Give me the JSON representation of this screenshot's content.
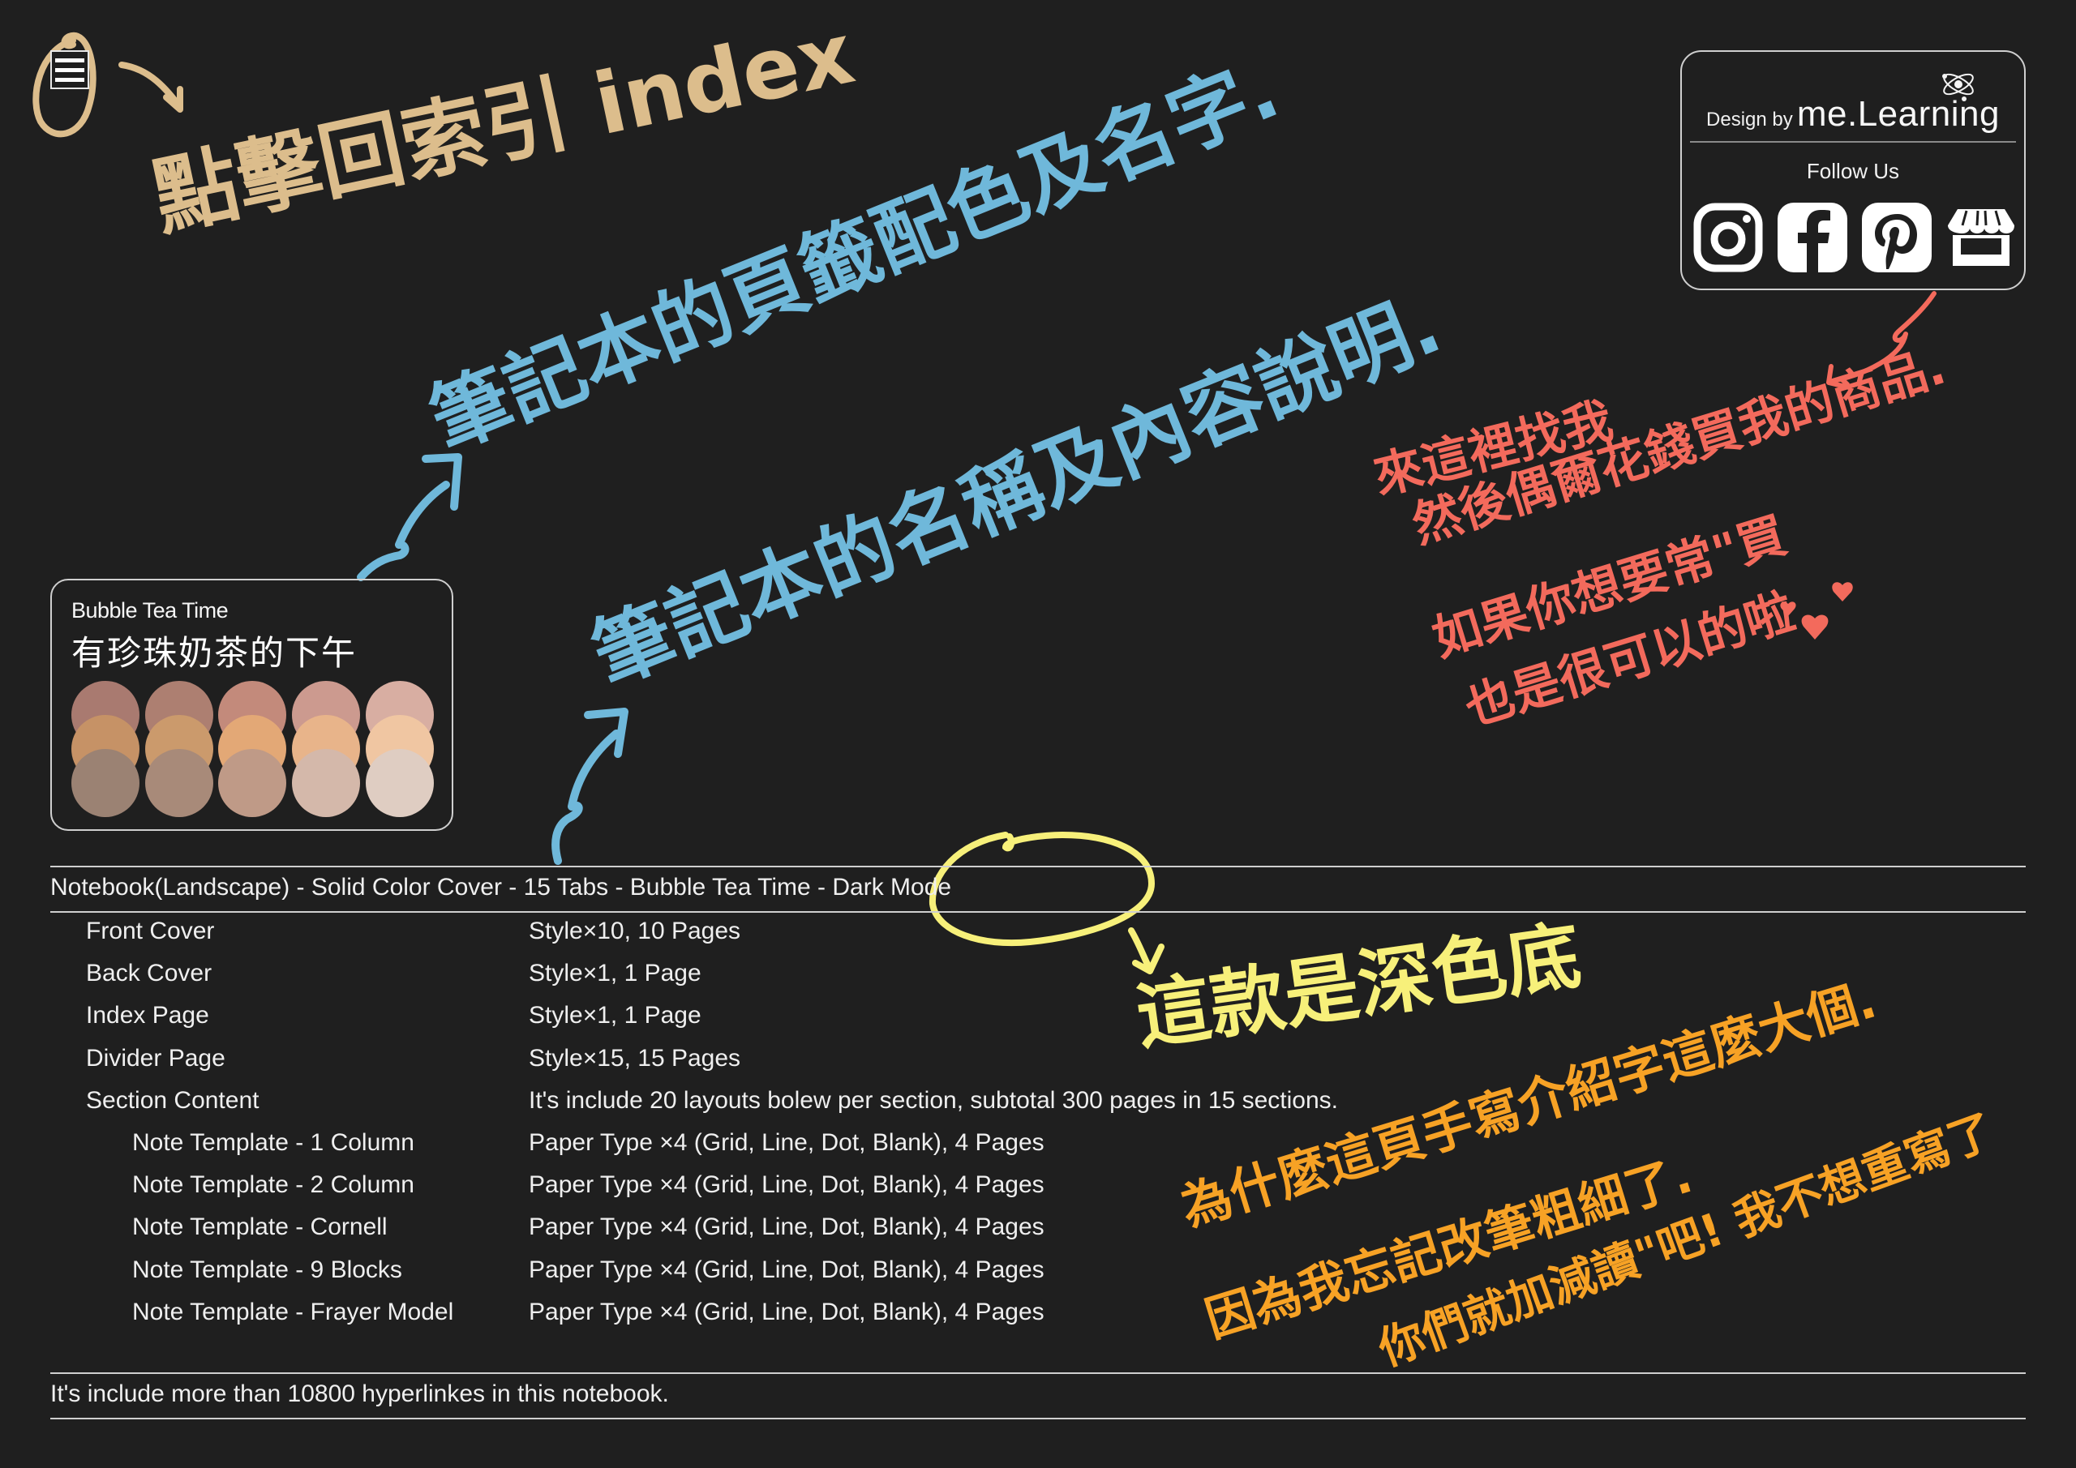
{
  "nav": {
    "index_button_label": "Index",
    "index_annotation": "點擊回索引 index"
  },
  "brand": {
    "design_by": "Design by",
    "name": "me.Learning",
    "follow_label": "Follow Us",
    "socials": [
      {
        "name": "instagram",
        "icon": "instagram-icon"
      },
      {
        "name": "facebook",
        "icon": "facebook-icon"
      },
      {
        "name": "pinterest",
        "icon": "pinterest-icon"
      },
      {
        "name": "shop",
        "icon": "storefront-icon"
      }
    ]
  },
  "palette": {
    "title_en": "Bubble Tea Time",
    "title_zh": "有珍珠奶茶的下午",
    "rows": [
      [
        "#a97a70",
        "#ad7f71",
        "#c38a7b",
        "#cc9a8f",
        "#d8aea2"
      ],
      [
        "#c69266",
        "#cb9a6c",
        "#e3a876",
        "#e8b48a",
        "#f0c6a2"
      ],
      [
        "#9b8273",
        "#a88a79",
        "#bf9a87",
        "#d4b8aa",
        "#dfcdc2"
      ]
    ]
  },
  "annotations": {
    "blue_1": "筆記本的頁籤配色及名字.",
    "blue_2": "筆記本的名稱及內容說明.",
    "red_lines": [
      "來這裡找我",
      "然後偶爾花錢買我的商品.",
      "如果你想要常\"買",
      "也是很可以的啦"
    ],
    "yellow": "這款是深色底",
    "orange_lines": [
      "為什麼這頁手寫介紹字這麼大個.",
      "因為我忘記改筆粗細了.",
      "你們就加減讀\"吧! 我不想重寫了"
    ]
  },
  "spec": {
    "title": "Notebook(Landscape) - Solid Color Cover - 15 Tabs - Bubble Tea Time - Dark Mode",
    "rows": [
      {
        "label": "Front Cover",
        "value": "Style×10, 10 Pages",
        "indent": 1
      },
      {
        "label": "Back Cover",
        "value": "Style×1, 1 Page",
        "indent": 1
      },
      {
        "label": "Index Page",
        "value": "Style×1, 1 Page",
        "indent": 1
      },
      {
        "label": "Divider Page",
        "value": "Style×15, 15 Pages",
        "indent": 1
      },
      {
        "label": "Section Content",
        "value": "It's include 20 layouts bolew per section, subtotal 300 pages in 15 sections.",
        "indent": 1
      },
      {
        "label": "Note Template - 1 Column",
        "value": "Paper Type ×4 (Grid, Line, Dot, Blank), 4 Pages",
        "indent": 2
      },
      {
        "label": "Note Template - 2 Column",
        "value": "Paper Type ×4 (Grid, Line, Dot, Blank), 4 Pages",
        "indent": 2
      },
      {
        "label": "Note Template - Cornell",
        "value": "Paper Type ×4 (Grid, Line, Dot, Blank), 4 Pages",
        "indent": 2
      },
      {
        "label": "Note Template - 9 Blocks",
        "value": "Paper Type ×4 (Grid, Line, Dot, Blank), 4 Pages",
        "indent": 2
      },
      {
        "label": "Note Template - Frayer Model",
        "value": "Paper Type ×4 (Grid, Line, Dot, Blank), 4 Pages",
        "indent": 2
      }
    ],
    "footer": "It's include more than 10800 hyperlinkes in this notebook."
  },
  "colors": {
    "background": "#1f1f1f",
    "tan": "#dcbd8c",
    "blue": "#6fb8da",
    "red": "#f36a5c",
    "yellow": "#f7f07a",
    "orange": "#f7a225"
  }
}
